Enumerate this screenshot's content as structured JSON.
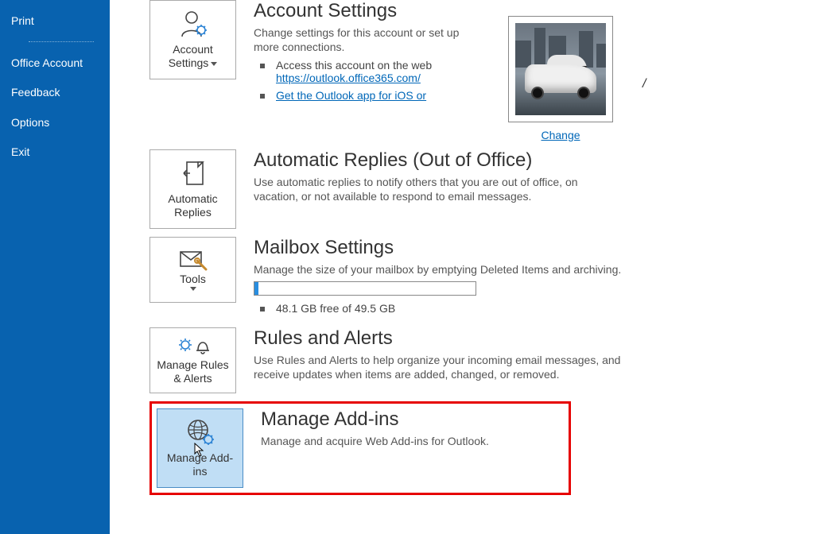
{
  "sidebar": {
    "items": [
      {
        "label": "Print"
      },
      {
        "label": "Office Account"
      },
      {
        "label": "Feedback"
      },
      {
        "label": "Options"
      },
      {
        "label": "Exit"
      }
    ]
  },
  "accountSettings": {
    "tileLabel": "Account Settings",
    "title": "Account Settings",
    "desc": "Change settings for this account or set up more connections.",
    "bullets": {
      "accessWeb": "Access this account on the web",
      "webUrl": "https://outlook.office365.com/",
      "getApp": "Get the Outlook app for iOS or"
    },
    "danglingSlash": "/",
    "photoChange": "Change"
  },
  "autoReplies": {
    "tileLabel": "Automatic Replies",
    "title": "Automatic Replies (Out of Office)",
    "desc": "Use automatic replies to notify others that you are out of office, on vacation, or not available to respond to email messages."
  },
  "mailbox": {
    "tileLabel": "Tools",
    "title": "Mailbox Settings",
    "desc": "Manage the size of your mailbox by emptying Deleted Items and archiving.",
    "storage": "48.1 GB free of 49.5 GB"
  },
  "rules": {
    "tileLabel": "Manage Rules & Alerts",
    "title": "Rules and Alerts",
    "desc": "Use Rules and Alerts to help organize your incoming email messages, and receive updates when items are added, changed, or removed."
  },
  "addins": {
    "tileLabel": "Manage Add-ins",
    "title": "Manage Add-ins",
    "desc": "Manage and acquire Web Add-ins for Outlook."
  }
}
